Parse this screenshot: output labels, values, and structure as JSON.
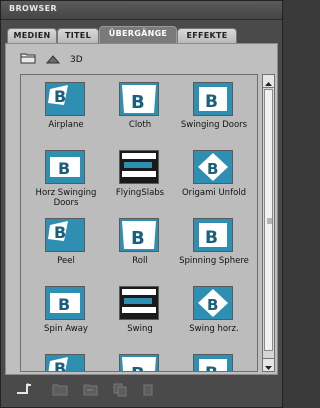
{
  "window": {
    "title": "BROWSER"
  },
  "tabs": [
    {
      "label": "MEDIEN",
      "active": false
    },
    {
      "label": "TITEL",
      "active": false
    },
    {
      "label": "ÜBERGÄNGE",
      "active": true
    },
    {
      "label": "EFFEKTE",
      "active": false
    }
  ],
  "toolbar": {
    "mode_label": "3D"
  },
  "transitions": [
    {
      "label": "Airplane"
    },
    {
      "label": "Cloth"
    },
    {
      "label": "Swinging Doors"
    },
    {
      "label": "Horz Swinging Doors"
    },
    {
      "label": "FlyingSlabs"
    },
    {
      "label": "Origami Unfold"
    },
    {
      "label": "Peel"
    },
    {
      "label": "Roll"
    },
    {
      "label": "Spinning Sphere"
    },
    {
      "label": "Spin Away"
    },
    {
      "label": "Swing"
    },
    {
      "label": "Swing horz."
    },
    {
      "label": ""
    },
    {
      "label": ""
    },
    {
      "label": ""
    }
  ],
  "colors": {
    "thumb_blue": "#2f8fb3",
    "thumb_dark": "#1b5f7a"
  }
}
